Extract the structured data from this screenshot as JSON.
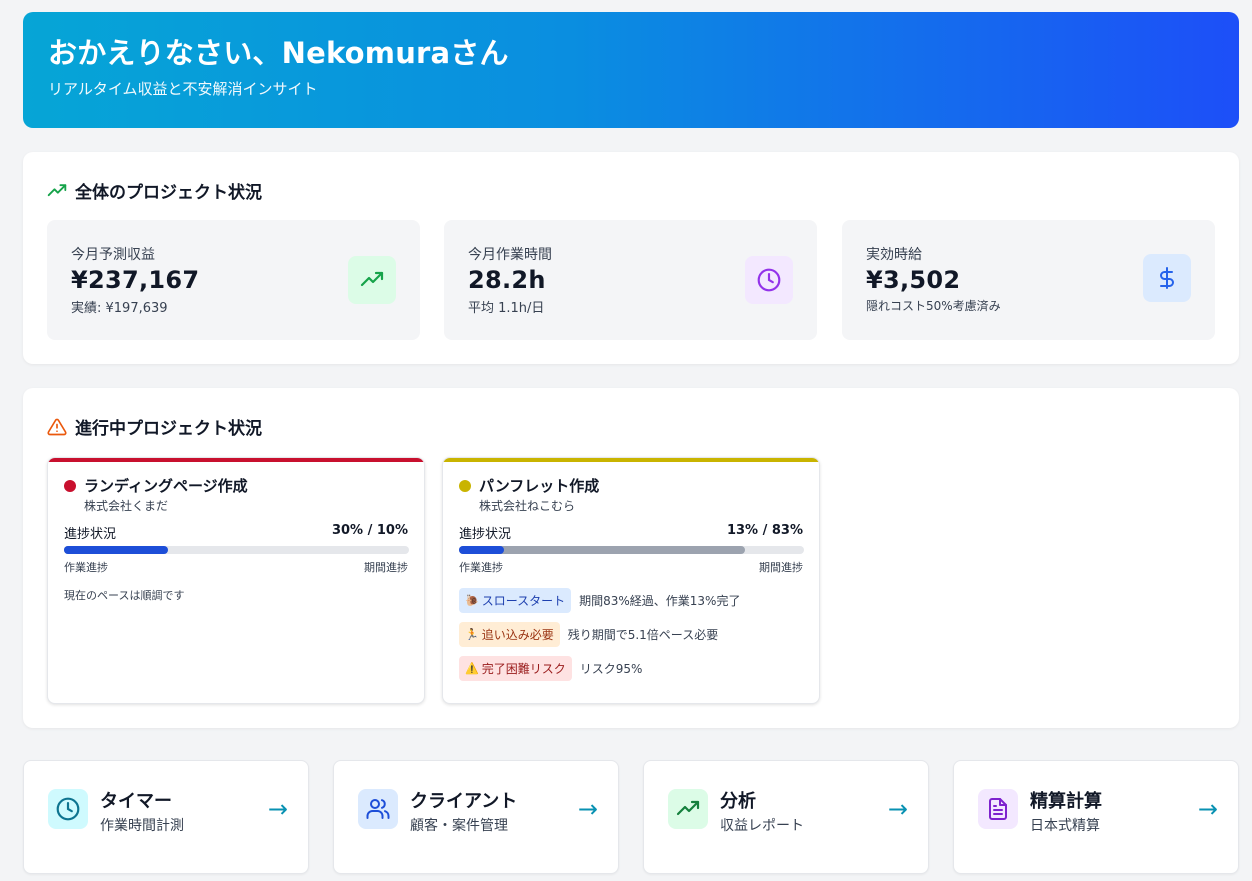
{
  "hero": {
    "greeting": "おかえりなさい、Nekomuraさん",
    "subtitle": "リアルタイム収益と不安解消インサイト"
  },
  "overview": {
    "title": "全体のプロジェクト状況",
    "stats": [
      {
        "label": "今月予測収益",
        "value": "¥237,167",
        "sub": "実績: ¥197,639",
        "icon": "trending-up-icon",
        "color": "#16a34a",
        "bg": "#dcfce7"
      },
      {
        "label": "今月作業時間",
        "value": "28.2h",
        "sub": "平均 1.1h/日",
        "icon": "clock-icon",
        "color": "#9333ea",
        "bg": "#f3e8ff"
      },
      {
        "label": "実効時給",
        "value": "¥3,502",
        "sub": "隠れコスト50%考慮済み",
        "icon": "dollar-icon",
        "color": "#2563eb",
        "bg": "#dbeafe"
      }
    ]
  },
  "projects": {
    "title": "進行中プロジェクト状況",
    "items": [
      {
        "name": "ランディングページ作成",
        "client": "株式会社くまだ",
        "status_color": "#c8102e",
        "progress_label": "進捗状況",
        "progress_value": "30% / 10%",
        "work_progress": 30,
        "period_progress": 10,
        "work_caption": "作業進捗",
        "period_caption": "期間進捗",
        "note": "現在のペースは順調です",
        "badges": []
      },
      {
        "name": "パンフレット作成",
        "client": "株式会社ねこむら",
        "status_color": "#c9b400",
        "progress_label": "進捗状況",
        "progress_value": "13% / 83%",
        "work_progress": 13,
        "period_progress": 83,
        "work_caption": "作業進捗",
        "period_caption": "期間進捗",
        "note": "",
        "badges": [
          {
            "emoji": "🐌",
            "label": "スロースタート",
            "desc": "期間83%経過、作業13%完了",
            "bg": "#dbeafe",
            "fg": "#1e40af"
          },
          {
            "emoji": "🏃",
            "label": "追い込み必要",
            "desc": "残り期間で5.1倍ペース必要",
            "bg": "#ffedd5",
            "fg": "#9a3412"
          },
          {
            "emoji": "⚠️",
            "label": "完了困難リスク",
            "desc": "リスク95%",
            "bg": "#fee2e2",
            "fg": "#991b1b"
          }
        ]
      }
    ]
  },
  "nav": [
    {
      "title": "タイマー",
      "sub": "作業時間計測",
      "icon": "clock-icon",
      "color": "#0e7490",
      "bg": "#cffafe",
      "arrow": "→"
    },
    {
      "title": "クライアント",
      "sub": "顧客・案件管理",
      "icon": "users-icon",
      "color": "#1d4ed8",
      "bg": "#dbeafe",
      "arrow": "→"
    },
    {
      "title": "分析",
      "sub": "収益レポート",
      "icon": "trending-up-icon",
      "color": "#15803d",
      "bg": "#dcfce7",
      "arrow": "→"
    },
    {
      "title": "精算計算",
      "sub": "日本式精算",
      "icon": "document-icon",
      "color": "#7e22ce",
      "bg": "#f3e8ff",
      "arrow": "→"
    }
  ]
}
